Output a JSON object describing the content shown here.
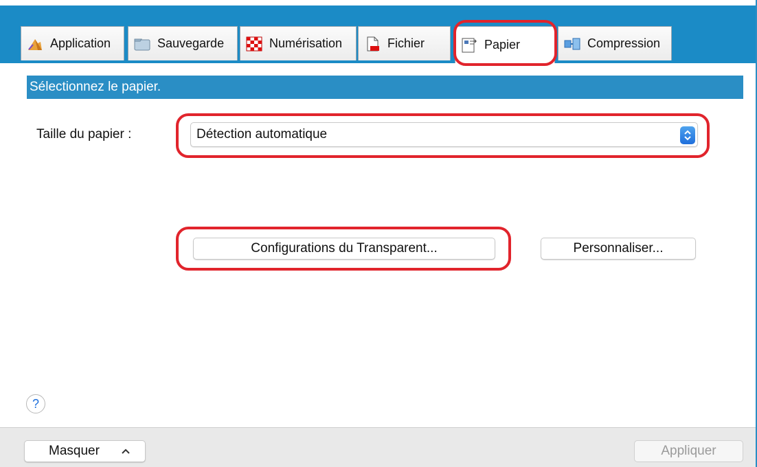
{
  "tabs": [
    {
      "label": "Application",
      "icon": "application-icon"
    },
    {
      "label": "Sauvegarde",
      "icon": "folder-icon"
    },
    {
      "label": "Numérisation",
      "icon": "scan-checker-icon"
    },
    {
      "label": "Fichier",
      "icon": "file-pdf-icon"
    },
    {
      "label": "Papier",
      "icon": "paper-icon",
      "active": true
    },
    {
      "label": "Compression",
      "icon": "compression-icon"
    }
  ],
  "section": {
    "title": "Sélectionnez le papier."
  },
  "paper_size": {
    "label": "Taille du papier :",
    "value": "Détection automatique"
  },
  "buttons": {
    "transparent": "Configurations du Transparent...",
    "customize": "Personnaliser...",
    "hide": "Masquer",
    "apply": "Appliquer"
  },
  "help": {
    "glyph": "?"
  },
  "colors": {
    "header_blue": "#2a8ec5",
    "highlight_red": "#e1242c"
  }
}
